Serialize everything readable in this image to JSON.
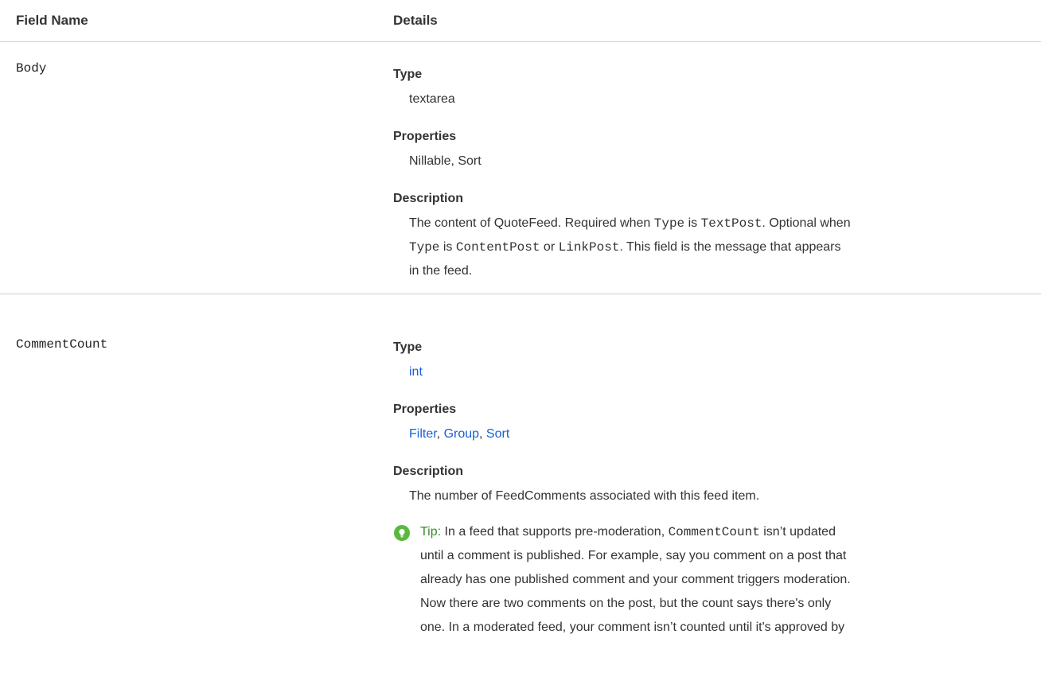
{
  "header": {
    "field_name": "Field Name",
    "details": "Details"
  },
  "fields": [
    {
      "name": "Body",
      "type_label": "Type",
      "type_value": "textarea",
      "properties_label": "Properties",
      "properties_value": "Nillable, Sort",
      "description_label": "Description",
      "description": {
        "line1_a": "The content of QuoteFeed. Required when ",
        "line1_code1": "Type",
        "line1_b": " is ",
        "line1_code2": "TextPost",
        "line1_c": ". Optional when",
        "line2_code1": "Type",
        "line2_a": " is ",
        "line2_code2": "ContentPost",
        "line2_b": " or ",
        "line2_code3": "LinkPost",
        "line2_c": ". This field is the message that appears",
        "line3": "in the feed."
      }
    },
    {
      "name": "CommentCount",
      "type_label": "Type",
      "type_value": "int",
      "properties_label": "Properties",
      "properties": {
        "filter": "Filter",
        "sep1": ", ",
        "group": "Group",
        "sep2": ", ",
        "sort": "Sort"
      },
      "description_label": "Description",
      "description": "The number of FeedComments associated with this feed item.",
      "tip": {
        "label": "Tip:",
        "line1_a": " In a feed that supports pre-moderation, ",
        "line1_code": "CommentCount",
        "line1_b": " isn’t updated",
        "line2": "until a comment is published. For example, say you comment on a post that",
        "line3": "already has one published comment and your comment triggers moderation.",
        "line4": "Now there are two comments on the post, but the count says there's only",
        "line5": "one. In a moderated feed, your comment isn’t counted until it's approved by"
      }
    }
  ],
  "colors": {
    "link": "#1a5fd3",
    "tip_icon": "#5bb83e",
    "tip_label": "#3a8a2c",
    "divider": "#cfcfcf"
  },
  "icons": {
    "tip": "lightbulb-icon"
  }
}
